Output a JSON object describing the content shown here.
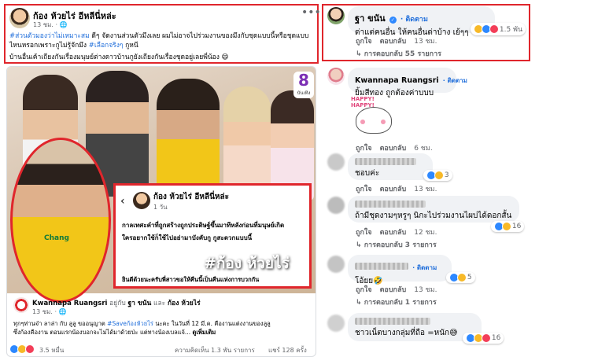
{
  "left_post": {
    "author": "ก้อง ห้วยไร่ อีหลีนี่หล่ะ",
    "time": "13 ชม.",
    "menu_icon": "more-dots-icon",
    "body_line1_tag": "#ส่วนตัวมองว่าไม่เหมาะสม",
    "body_line1_rest": " ดีๆ จัดงานส่วนตัวมึงเลย ผมไม่อาจไปร่วมงานของมึงกับชุดแบบนี้หรือชุดแบบ",
    "body_line2_a": "ไหนหรอกเพราะกูไม่รู้จักมึง ",
    "body_line2_tag": "#เลือกจริงๆ",
    "body_line2_b": " กูหนี",
    "body_line3": "บ้านอื่นเค้าเถียงกันเรื่องมนุษย์ต่างดาวบ้านกูยังเถียงกันเรื่องชุดอยู่เลยพี่น้อง 😄"
  },
  "media": {
    "channel_logo": "8",
    "channel_sub": "บันเทิง",
    "hashtag_overlay": "#ก้อง ห้วยไร่",
    "inset_author": "ก้อง ห้วยไร่ อีหลีนี่หล่ะ",
    "inset_time": "1 วัน",
    "inset_line1": "กาลเทศะคำที่ถูกสร้างถูกประดิษฐ์ขึ้นมาทีหลังก่อนที่มนุษย์เกิด",
    "inset_line2": "ใครอยากใช้ก็ใช้ไปอย่ามาบังคับกู กูสะดวกแบบนี้",
    "inset_line3": "ยินดีด้วยนะครับพี่สาวขอให้คืนนี้เป็นคืนแห่งการบวกกัน",
    "shirt_brand": "Chang"
  },
  "shared_post": {
    "author": "Kwannapa Ruangsri",
    "with_text": " อยู่กับ ",
    "tag1": "ฐา ขนัน",
    "and_text": " และ ",
    "tag2": "ก้อง ห้วยไร่",
    "time": "13 ชม.",
    "body1_a": "ทุกๆท่านจ๋า ลาล่า กับ ลูลู ขออนุญาต ",
    "body1_tag": "#Saveก้องห้วยไร่",
    "body1_b": " นะคะ ในวันที่ 12 มี.ค. คืองานแต่งงานของลูลู",
    "body2": "ซึ่งก้องคืองาน ตอนแรกน้องบอกจะไม่ได้มาด้วยป่ะ แต่ทางน้องเบลแจ้...",
    "see_more": "ดูเพิ่มเติม"
  },
  "post_footer": {
    "reactions": "3.5 หมื่น",
    "comments": "ความคิดเห็น 1.3 พัน รายการ",
    "shares": "แชร์ 128 ครั้ง"
  },
  "comments": [
    {
      "name": "ฐา ขนัน",
      "follow": "· ติดตาม",
      "text": "ด่าแต่คนอื่น ให้คนอื่นด่าบ้าง เย้ๆๆ",
      "like": "ถูกใจ",
      "reply": "ตอบกลับ",
      "time": "13 ชม.",
      "reactions": "1.5 พัน",
      "replies": "การตอบกลับ 55 รายการ"
    },
    {
      "name": "Kwannapa Ruangsri",
      "follow": "· ติดตาม",
      "text": "ยิ้มสีทอง ถูกต้องค่าบบบ",
      "sticker": "HAPPY! HAPPY!",
      "like": "ถูกใจ",
      "reply": "ตอบกลับ",
      "time": "6 ชม."
    },
    {
      "text": "ชอบค่ะ",
      "like": "ถูกใจ",
      "reply": "ตอบกลับ",
      "time": "13 ชม.",
      "reactions": "3"
    },
    {
      "text": "ถ้ามีชุดงามๆหรูๆ นิกะไปร่วมงานไผบ่ได้ดอกสั้น",
      "like": "ถูกใจ",
      "reply": "ตอบกลับ",
      "time": "12 ชม.",
      "reactions": "16",
      "replies": "การตอบกลับ 3 รายการ"
    },
    {
      "text": "โอ้ยย🤣",
      "follow": "· ติดตาม",
      "like": "ถูกใจ",
      "reply": "ตอบกลับ",
      "time": "13 ชม.",
      "reactions": "5",
      "replies": "การตอบกลับ 1 รายการ"
    },
    {
      "text": "ชาวเน็ตบางกลุ่มที่ถือ =หนัก😅",
      "reactions": "16"
    }
  ]
}
